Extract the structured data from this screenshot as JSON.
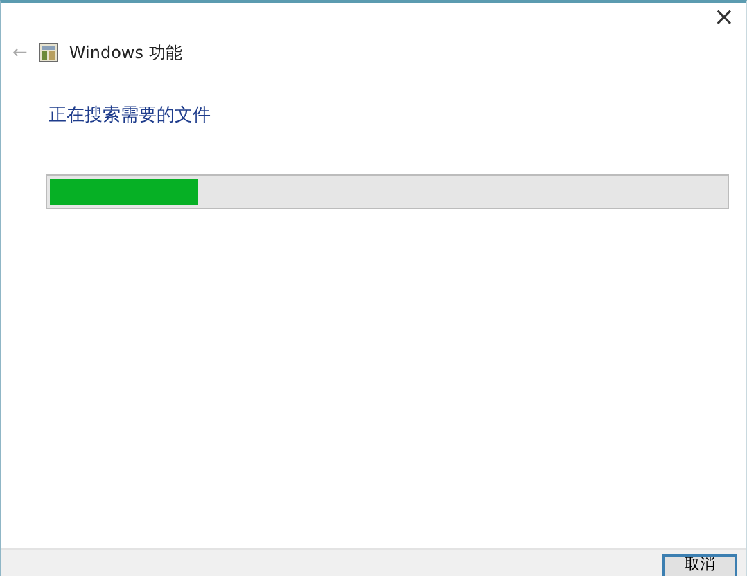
{
  "window": {
    "close": "×",
    "back": "←",
    "title": "Windows 功能"
  },
  "heading": "正在搜索需要的文件",
  "progress": {
    "level": 0.22
  },
  "buttons": [
    {
      "label": "取消",
      "kind": "default"
    }
  ]
}
